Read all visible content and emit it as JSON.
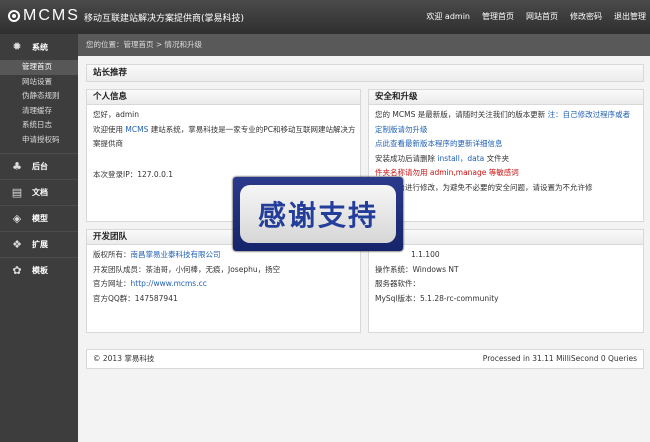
{
  "header": {
    "logo_text": "MCMS",
    "app_title": "移动互联建站解决方案提供商(掌易科技)",
    "welcome": "欢迎 admin",
    "nav": [
      "管理首页",
      "网站首页",
      "修改密码",
      "退出管理"
    ]
  },
  "sidebar": {
    "groups": [
      {
        "label": "系统",
        "icon": "gear-icon",
        "items": [
          "管理首页",
          "网站设置",
          "伪静态规则",
          "清理缓存",
          "系统日志",
          "申请授权码"
        ]
      },
      {
        "label": "后台",
        "icon": "apple-icon",
        "items": []
      },
      {
        "label": "文档",
        "icon": "document-icon",
        "items": []
      },
      {
        "label": "模型",
        "icon": "box-icon",
        "items": []
      },
      {
        "label": "扩展",
        "icon": "dropbox-icon",
        "items": []
      },
      {
        "label": "模板",
        "icon": "palette-icon",
        "items": []
      }
    ],
    "active_item": "管理首页"
  },
  "breadcrumb": "您的位置：管理首页 > 情况和升级",
  "main": {
    "title": "站长推荐",
    "personal": {
      "title": "个人信息",
      "greeting": "您好，admin",
      "welcome_pre": "欢迎使用 ",
      "welcome_link": "MCMS",
      "welcome_post": " 建站系统，掌易科技是一家专业的PC和移动互联网建站解决方",
      "welcome_cont": "案提供商",
      "last_login": "本次登录IP：127.0.0.1"
    },
    "security": {
      "title": "安全和升级",
      "line1_pre": "您的 MCMS 是最新版，请随时关注我们的版本更新 ",
      "line1_warn": "注：自己修改过程序或者",
      "line2": "定制版请勿升级",
      "update_link": "点此查看最新版本程序的更新详细信息",
      "install_pre": "安装成功后请删除 ",
      "install_files": "install，data",
      "install_post": " 文件夹",
      "red_line": "件夹名称请勿用 admin,manage 等敏感词",
      "tip": "以在后台进行修改，为避免不必要的安全问题，请设置为不允许修"
    },
    "team": {
      "title": "开发团队",
      "copyright_pre": "版权所有：",
      "copyright_link": "南昌掌易业泰科技有限公司",
      "members": "开发团队成员：茶油哥，小何棒，无痕，Josephu，扬空",
      "site_pre": "官方网址：",
      "site_link": "http://www.mcms.cc",
      "qq": "官方QQ群：147587941"
    },
    "server": {
      "version": "1.1.100",
      "os": "操作系统：Windows NT",
      "software": "服务器软件：",
      "mysql": "MySql版本：5.1.28-rc-community"
    },
    "footer_left": "© 2013   掌易科技",
    "footer_right": "Processed in 31.11 MilliSecond 0 Queries"
  },
  "overlay": {
    "text": "感谢支持"
  }
}
